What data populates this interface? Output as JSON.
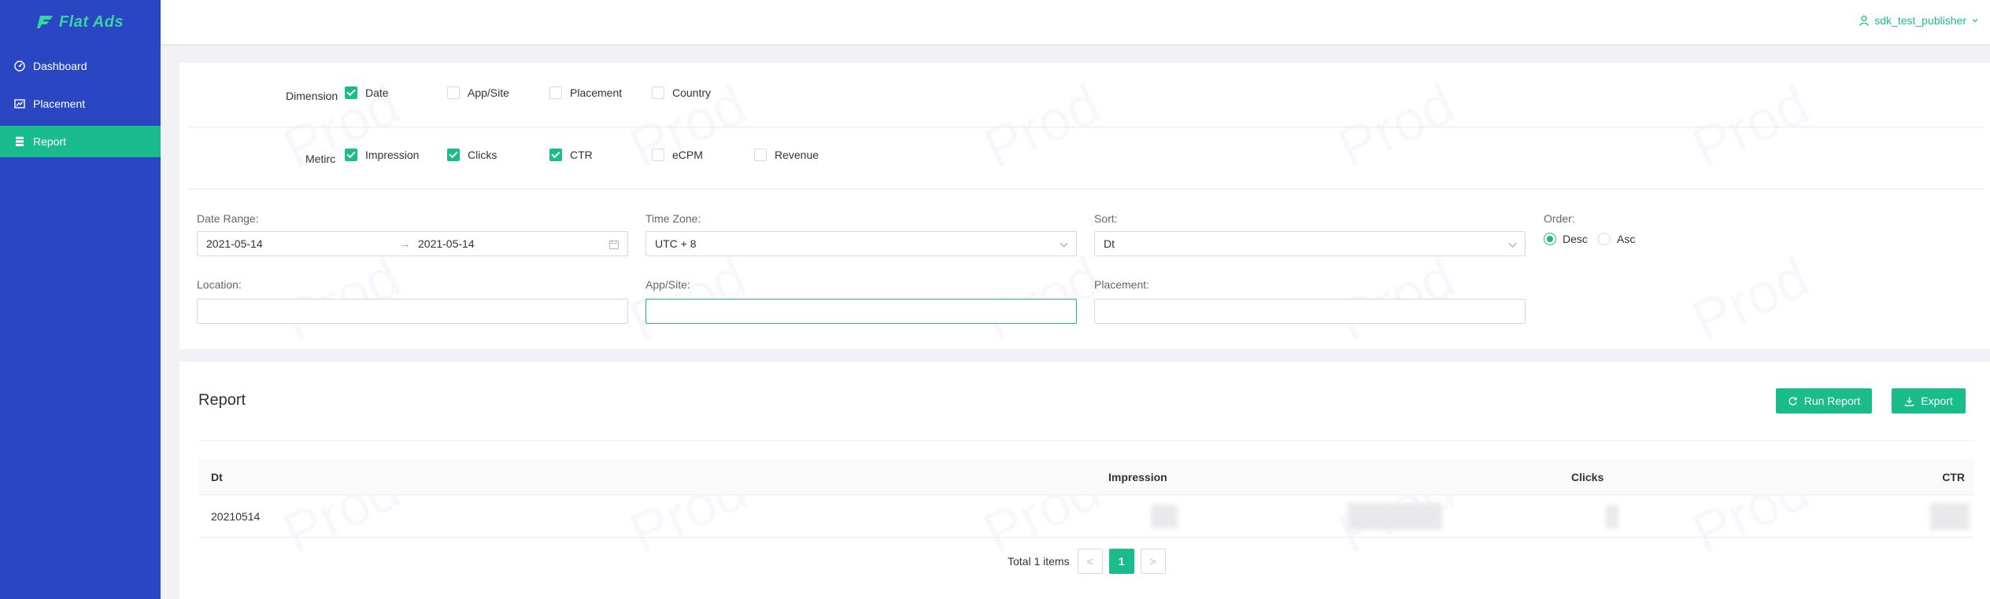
{
  "app": {
    "logo_text": "Flat Ads",
    "brand_color": "#1bbc8c",
    "sidebar_color": "#2a46c2"
  },
  "header": {
    "user": "sdk_test_publisher"
  },
  "sidebar": {
    "items": [
      {
        "label": "Dashboard",
        "icon": "dashboard-icon",
        "active": false
      },
      {
        "label": "Placement",
        "icon": "chart-icon",
        "active": false
      },
      {
        "label": "Report",
        "icon": "list-icon",
        "active": true
      }
    ]
  },
  "filters": {
    "dimension_label": "Dimension",
    "dimensions": [
      {
        "label": "Date",
        "checked": true
      },
      {
        "label": "App/Site",
        "checked": false
      },
      {
        "label": "Placement",
        "checked": false
      },
      {
        "label": "Country",
        "checked": false
      }
    ],
    "metric_label": "Metirc",
    "metrics": [
      {
        "label": "Impression",
        "checked": true
      },
      {
        "label": "Clicks",
        "checked": true
      },
      {
        "label": "CTR",
        "checked": true
      },
      {
        "label": "eCPM",
        "checked": false
      },
      {
        "label": "Revenue",
        "checked": false
      }
    ],
    "date_range_label": "Date Range:",
    "date_start": "2021-05-14",
    "date_end": "2021-05-14",
    "date_separator": "→",
    "timezone_label": "Time Zone:",
    "timezone_value": "UTC + 8",
    "sort_label": "Sort:",
    "sort_value": "Dt",
    "order_label": "Order:",
    "order_options": [
      {
        "label": "Desc",
        "checked": true
      },
      {
        "label": "Asc",
        "checked": false
      }
    ],
    "location_label": "Location:",
    "location_value": "",
    "appsite_label": "App/Site:",
    "appsite_value": "",
    "placement_label": "Placement:",
    "placement_value": ""
  },
  "report": {
    "title": "Report",
    "run_button": "Run Report",
    "export_button": "Export",
    "columns": [
      "Dt",
      "Impression",
      "Clicks",
      "CTR"
    ],
    "rows": [
      {
        "dt": "20210514"
      }
    ],
    "total_text": "Total 1 items",
    "current_page": "1",
    "prev": "<",
    "next": ">"
  },
  "watermark_text": "Prod"
}
